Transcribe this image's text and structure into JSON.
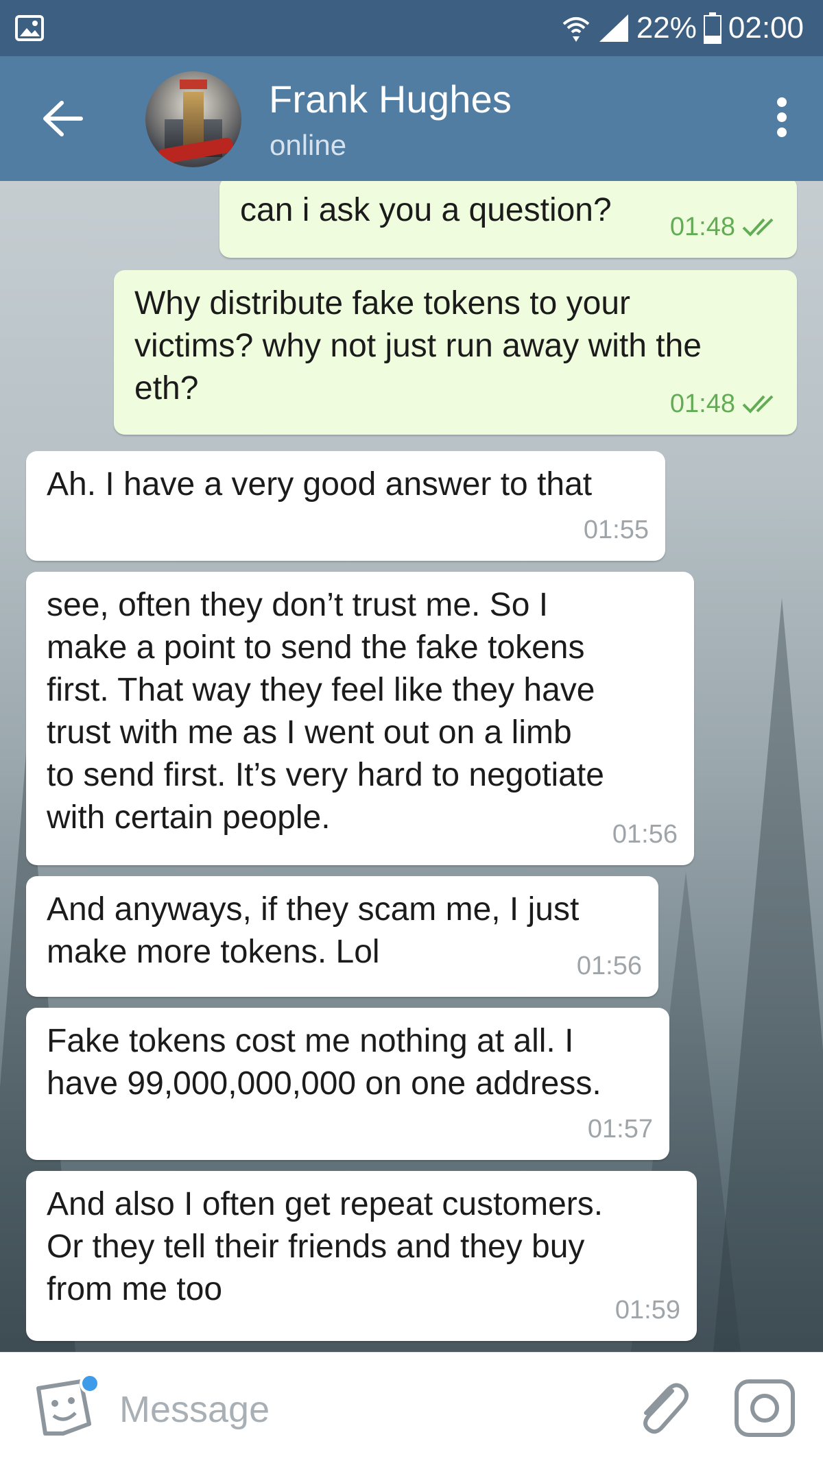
{
  "status_bar": {
    "battery": "22%",
    "time": "02:00",
    "icons": [
      "image-icon",
      "wifi-icon",
      "signal-icon",
      "battery-icon"
    ]
  },
  "header": {
    "title": "Frank Hughes",
    "subtitle": "online",
    "icons": [
      "back-arrow-icon",
      "more-vertical-icon"
    ]
  },
  "messages": [
    {
      "direction": "out",
      "text": "can i ask you a question?",
      "time": "01:48",
      "read": true
    },
    {
      "direction": "out",
      "text": "Why distribute fake tokens to your\nvictims? why not just run away with the\neth?",
      "time": "01:48",
      "read": true
    },
    {
      "direction": "in",
      "text": "Ah. I have a very good answer to that",
      "time": "01:55"
    },
    {
      "direction": "in",
      "text": "see, often they don’t trust me. So I\nmake a point to send the fake tokens\nfirst. That way they feel like they have\ntrust with me as I went out on a limb\nto send first. It’s very hard to negotiate\nwith certain people.",
      "time": "01:56"
    },
    {
      "direction": "in",
      "text": "And anyways, if they scam me, I just\nmake more tokens. Lol",
      "time": "01:56"
    },
    {
      "direction": "in",
      "text": "Fake tokens cost me nothing at all. I\nhave 99,000,000,000 on one address.",
      "time": "01:57"
    },
    {
      "direction": "in",
      "text": "And also I often get repeat customers.\nOr they tell their friends and they buy\nfrom me too",
      "time": "01:59"
    }
  ],
  "input_bar": {
    "placeholder": "Message",
    "icons": [
      "sticker-icon",
      "attach-icon",
      "camera-icon"
    ]
  },
  "colors": {
    "header": "#517da2",
    "status_bar": "#3d5f82",
    "outgoing_bubble": "#effdde",
    "incoming_bubble": "#ffffff",
    "read_check": "#62ac55"
  }
}
